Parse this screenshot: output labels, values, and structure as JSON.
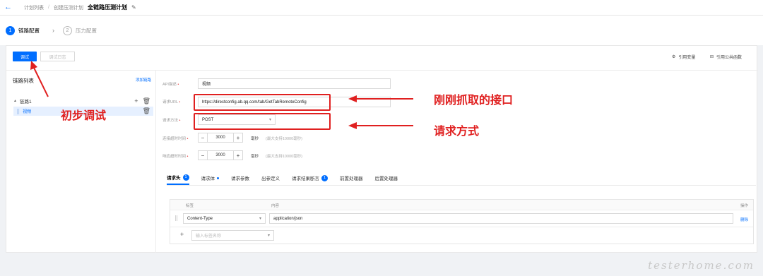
{
  "breadcrumb": {
    "items": [
      "计划列表",
      "创建压测计划"
    ],
    "current": "全链路压测计划"
  },
  "steps": [
    {
      "num": "1",
      "label": "链路配置"
    },
    {
      "num": "2",
      "label": "压力配置"
    }
  ],
  "toolbar": {
    "debug_label": "调试",
    "log_label": "调试日志",
    "ref_var": "引用变量",
    "ref_func": "引用公共函数"
  },
  "sidebar": {
    "title": "链路列表",
    "add_link": "添加链路",
    "link_name": "链路1",
    "api_name": "视频"
  },
  "form": {
    "api_desc_label": "API描述",
    "api_desc_value": "视频",
    "url_label": "请求URL",
    "url_value": "https://directconfig.ab.qq.com/tab/GetTabRemoteConfig",
    "method_label": "请求方法",
    "method_value": "POST",
    "connect_timeout_label": "连接超时时间",
    "connect_timeout_value": "3000",
    "response_timeout_label": "响应超时时间",
    "response_timeout_value": "3000",
    "unit": "毫秒",
    "hint": "(最大支持10000毫秒)"
  },
  "tabs": [
    {
      "label": "请求头",
      "badge": "1"
    },
    {
      "label": "请求体"
    },
    {
      "label": "请求参数"
    },
    {
      "label": "出参定义"
    },
    {
      "label": "请求结果断言",
      "badge": "1"
    },
    {
      "label": "前置处理器"
    },
    {
      "label": "后置处理器"
    }
  ],
  "table": {
    "headers": {
      "key": "标签",
      "content": "内容",
      "ops": "操作"
    },
    "row": {
      "key": "Content-Type",
      "value": "application/json",
      "delete": "删除"
    },
    "new_placeholder": "输入标签名称"
  },
  "annotations": {
    "debug": "初步调试",
    "url": "刚刚抓取的接口",
    "method": "请求方式",
    "annotation_color": "#e02020"
  },
  "watermark": "testerhome.com",
  "colors": {
    "accent": "#006eff"
  }
}
